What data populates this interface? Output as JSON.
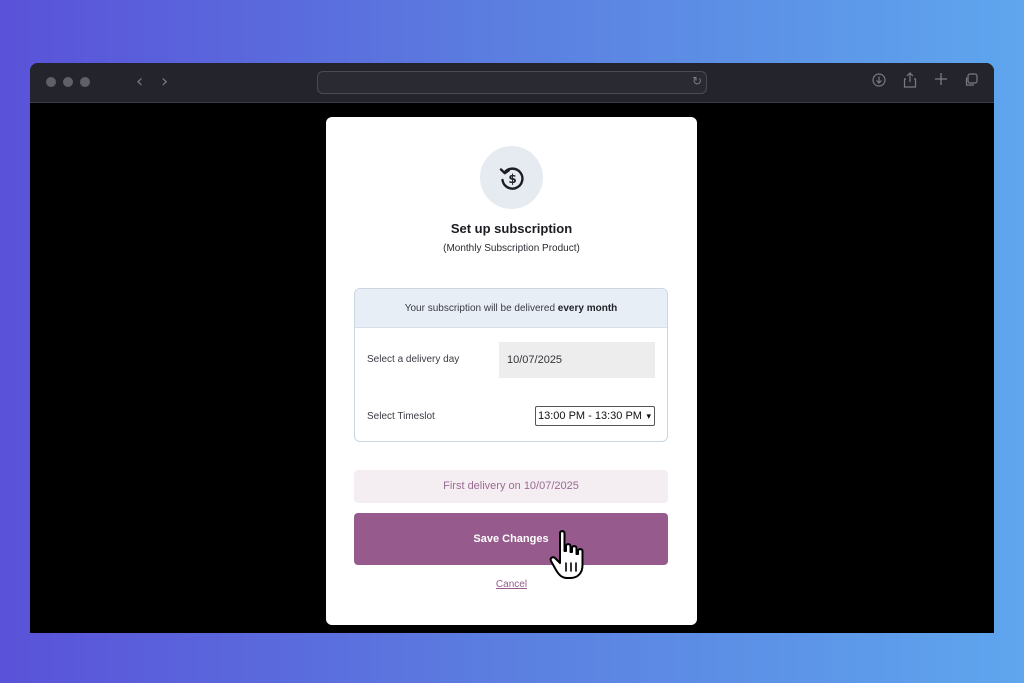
{
  "browser": {
    "url": "",
    "icons": [
      "back-icon",
      "forward-icon",
      "reload-icon",
      "download-icon",
      "share-icon",
      "new-tab-icon",
      "tabs-icon"
    ]
  },
  "modal": {
    "icon": "subscription-refresh-dollar-icon",
    "title": "Set up subscription",
    "subtitle": "(Monthly Subscription Product)",
    "info_prefix": "Your subscription will be delivered",
    "info_bold": "every month",
    "delivery_day_label": "Select a delivery day",
    "delivery_day_value": "10/07/2025",
    "timeslot_label": "Select Timeslot",
    "timeslot_value": "13:00 PM - 13:30 PM",
    "first_delivery": "First delivery on 10/07/2025",
    "save_label": "Save Changes",
    "cancel_label": "Cancel"
  },
  "colors": {
    "accent": "#965a8c",
    "accent_light": "#f4eef3",
    "info_bg": "#e8eef5"
  }
}
